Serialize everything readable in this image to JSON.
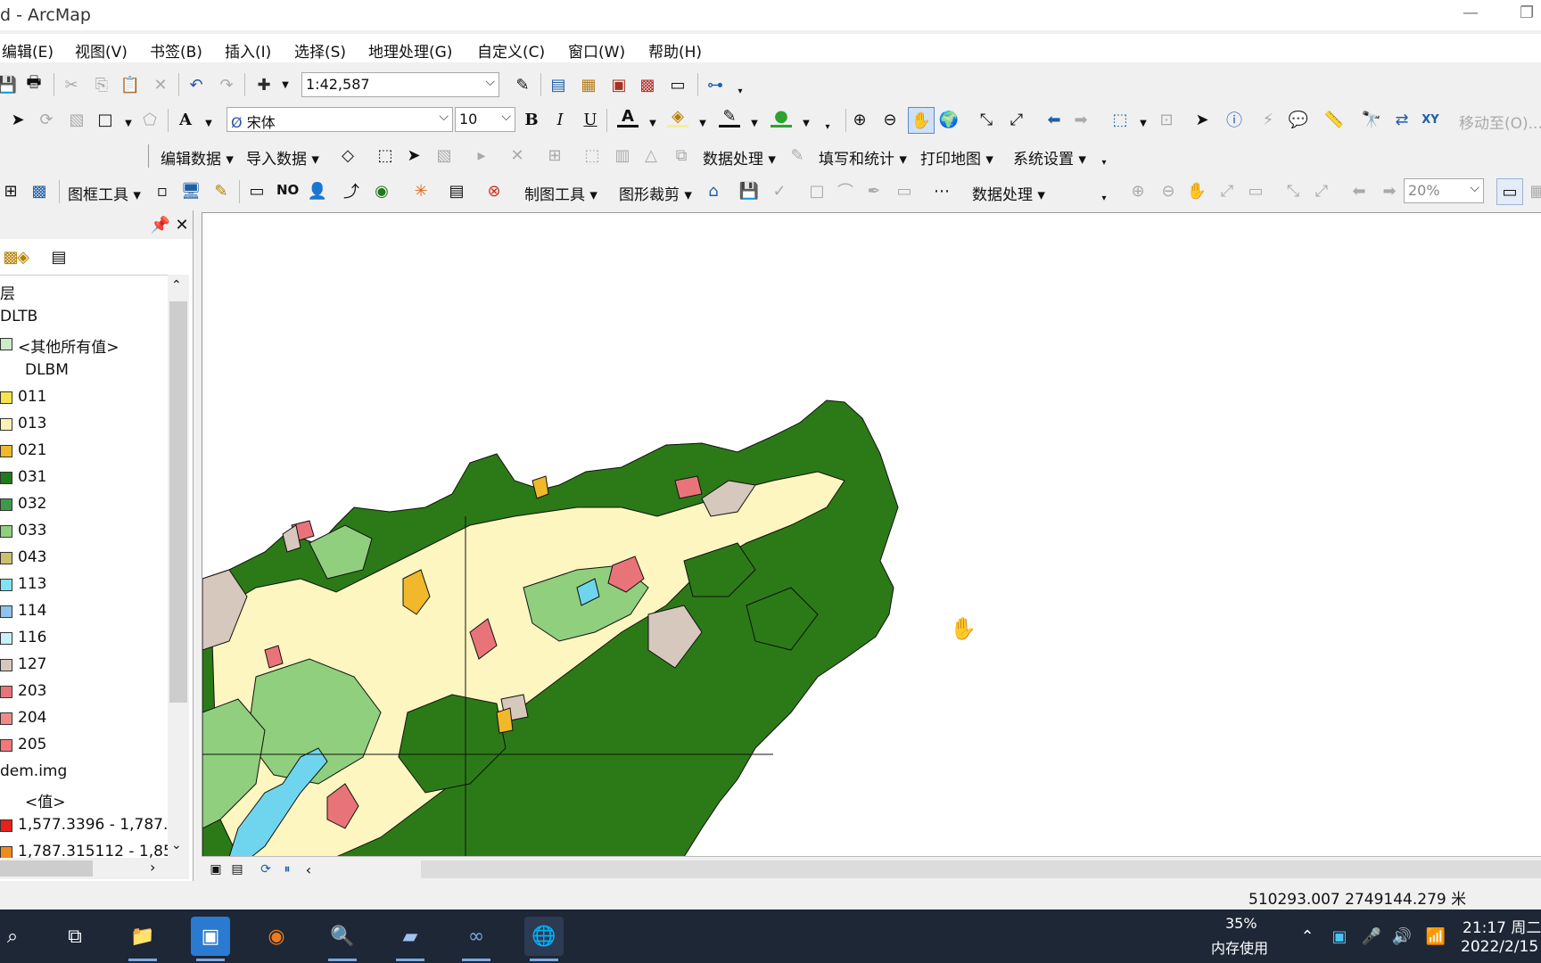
{
  "window": {
    "title": "d - ArcMap"
  },
  "menu": [
    "编辑(E)",
    "视图(V)",
    "书签(B)",
    "插入(I)",
    "选择(S)",
    "地理处理(G)",
    "自定义(C)",
    "窗口(W)",
    "帮助(H)"
  ],
  "toolbar": {
    "scale": "1:42,587",
    "font": "宋体",
    "font_size": "10",
    "bold": "B",
    "italic": "I",
    "underline": "U",
    "goto_label": "移动至(O)...",
    "edit_data": "编辑数据",
    "import_data": "导入数据",
    "data_process": "数据处理",
    "fill_stats": "填写和统计",
    "print_map": "打印地图",
    "sys_settings": "系统设置",
    "frame_tools": "图框工具",
    "no_label": "NO",
    "carto_tools": "制图工具",
    "clip_tools": "图形裁剪",
    "data_process2": "数据处理",
    "zoom_percent": "20%"
  },
  "toc": {
    "header_partial": "层",
    "rows": [
      {
        "text": "DLTB",
        "swatch": null
      },
      {
        "text": "<其他所有值>",
        "swatch": "#cdebc6"
      },
      {
        "text": "DLBM",
        "swatch": null
      },
      {
        "text": "011",
        "swatch": "#f5e44a"
      },
      {
        "text": "013",
        "swatch": "#fbf3b5"
      },
      {
        "text": "021",
        "swatch": "#f0b82a"
      },
      {
        "text": "031",
        "swatch": "#1f7a1a"
      },
      {
        "text": "032",
        "swatch": "#3e9a4a"
      },
      {
        "text": "033",
        "swatch": "#8fcf7d"
      },
      {
        "text": "043",
        "swatch": "#c9c26a"
      },
      {
        "text": "113",
        "swatch": "#7fe3f5"
      },
      {
        "text": "114",
        "swatch": "#8fc2ef"
      },
      {
        "text": "116",
        "swatch": "#c9f1f7"
      },
      {
        "text": "127",
        "swatch": "#d6c8bd"
      },
      {
        "text": "203",
        "swatch": "#e8747a"
      },
      {
        "text": "204",
        "swatch": "#f28a8a"
      },
      {
        "text": "205",
        "swatch": "#f07a7a"
      },
      {
        "text": "dem.img",
        "swatch": null
      },
      {
        "text": "<值>",
        "swatch": null
      },
      {
        "text": "1,577.3396 - 1,787.3",
        "swatch": "#e8211c"
      },
      {
        "text": "1,787.315112 - 1,85",
        "swatch": "#f08a1c"
      }
    ]
  },
  "map": {
    "colors": {
      "forest": "#2b7a17",
      "light": "#fdf6c0",
      "meadow": "#8fcf7d",
      "builtup": "#e8747a",
      "bare": "#d6c8bd",
      "water": "#6fd5ee",
      "orange": "#f0b82a"
    }
  },
  "status": {
    "coords": "510293.007  2749144.279 米"
  },
  "taskbar": {
    "mem_percent": "35%",
    "mem_label": "内存使用",
    "time": "21:17 周二",
    "date": "2022/2/15"
  }
}
